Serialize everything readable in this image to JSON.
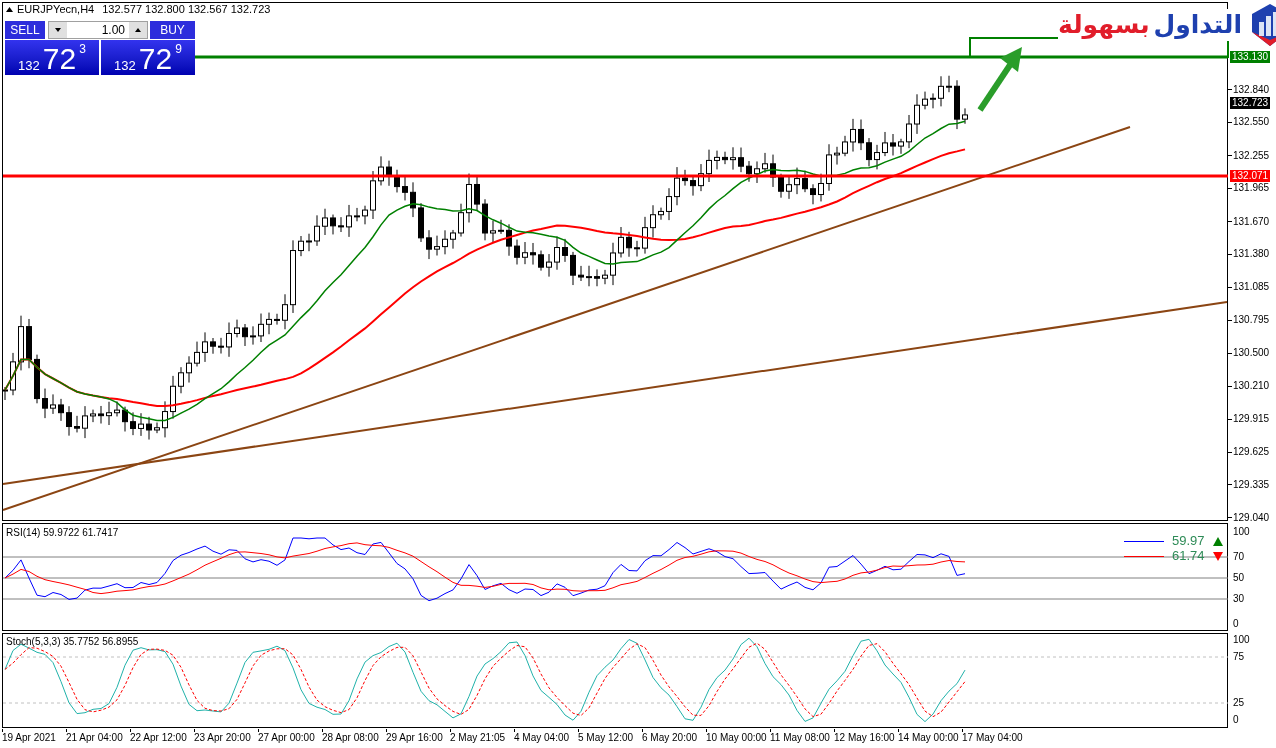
{
  "chart_header": {
    "symbol": "EURJPYecn,H4",
    "ohlc": "132.577 132.800 132.567 132.723"
  },
  "trade_panel": {
    "sell_label": "SELL",
    "buy_label": "BUY",
    "lot": "1.00",
    "sell_price": {
      "big_figure": "132",
      "pips": "72",
      "fraction": "3"
    },
    "buy_price": {
      "big_figure": "132",
      "pips": "72",
      "fraction": "9"
    }
  },
  "logo": {
    "words": [
      {
        "text": "التداول",
        "color": "#1e40af"
      },
      {
        "text": "بسهولة",
        "color": "#e11d2a"
      }
    ]
  },
  "price_axis": {
    "ticks": [
      "132.840",
      "132.550",
      "132.255",
      "131.965",
      "131.670",
      "131.380",
      "131.085",
      "130.795",
      "130.500",
      "130.210",
      "129.915",
      "129.625",
      "129.335",
      "129.040"
    ],
    "markers": [
      {
        "text": "133.130",
        "color": "#008000"
      },
      {
        "text": "132.723",
        "color": "#000000"
      },
      {
        "text": "132.071",
        "color": "#ff0000"
      }
    ]
  },
  "rsi": {
    "title": "RSI(14) 59.9722 61.7417",
    "axis": [
      "100",
      "70",
      "50",
      "30",
      "0"
    ],
    "legend": [
      {
        "value": "59.97",
        "color": "#0000ff",
        "rising": true
      },
      {
        "value": "61.74",
        "color": "#ff0000",
        "rising": false
      }
    ]
  },
  "stochastic": {
    "title": "Stoch(5,3,3) 35.7752 56.8955",
    "axis": [
      "100",
      "75",
      "25",
      "0"
    ]
  },
  "time_axis": [
    "19 Apr 2021",
    "21 Apr 04:00",
    "22 Apr 12:00",
    "23 Apr 20:00",
    "27 Apr 00:00",
    "28 Apr 08:00",
    "29 Apr 16:00",
    "2 May 21:05",
    "4 May 04:00",
    "5 May 12:00",
    "6 May 20:00",
    "10 May 00:00",
    "11 May 08:00",
    "12 May 16:00",
    "14 May 00:00",
    "17 May 04:00"
  ]
}
